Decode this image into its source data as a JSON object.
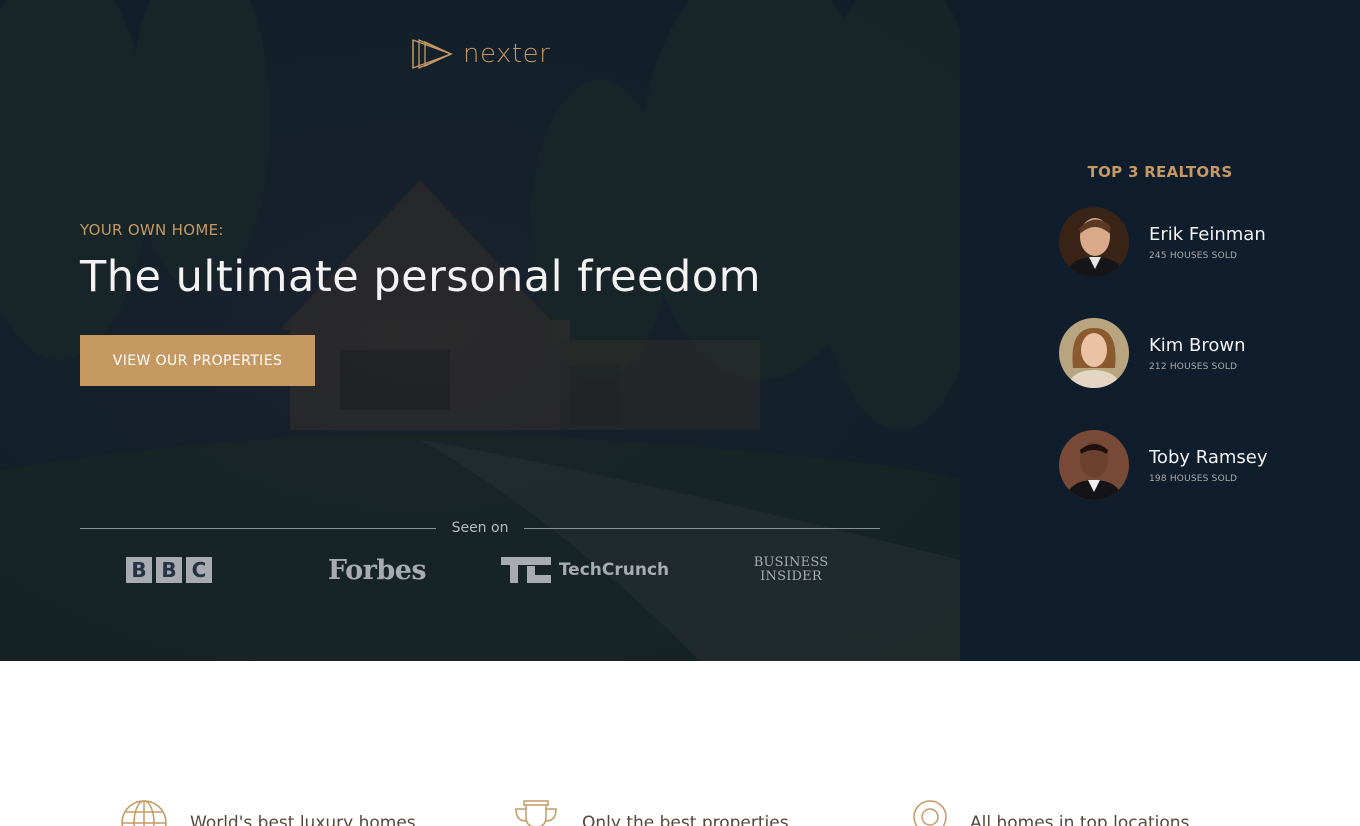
{
  "brand": {
    "name": "nexter",
    "accent": "#c69963",
    "dark": "#101d2c"
  },
  "hero": {
    "eyebrow": "YOUR OWN HOME:",
    "headline": "The ultimate personal freedom",
    "cta_label": "VIEW OUR PROPERTIES",
    "seen_on": "Seen on",
    "press": {
      "bbc": [
        "B",
        "B",
        "C"
      ],
      "forbes": "Forbes",
      "techcrunch": "TechCrunch",
      "bi_line1": "BUSINESS",
      "bi_line2": "INSIDER"
    }
  },
  "realtors": {
    "title": "TOP 3 REALTORS",
    "items": [
      {
        "name": "Erik Feinman",
        "sold": "245 HOUSES SOLD"
      },
      {
        "name": "Kim Brown",
        "sold": "212 HOUSES SOLD"
      },
      {
        "name": "Toby Ramsey",
        "sold": "198 HOUSES SOLD"
      }
    ]
  },
  "features": [
    {
      "icon": "globe-icon",
      "title": "World's best luxury homes"
    },
    {
      "icon": "trophy-icon",
      "title": "Only the best properties"
    },
    {
      "icon": "map-pin-icon",
      "title": "All homes in top locations"
    }
  ]
}
